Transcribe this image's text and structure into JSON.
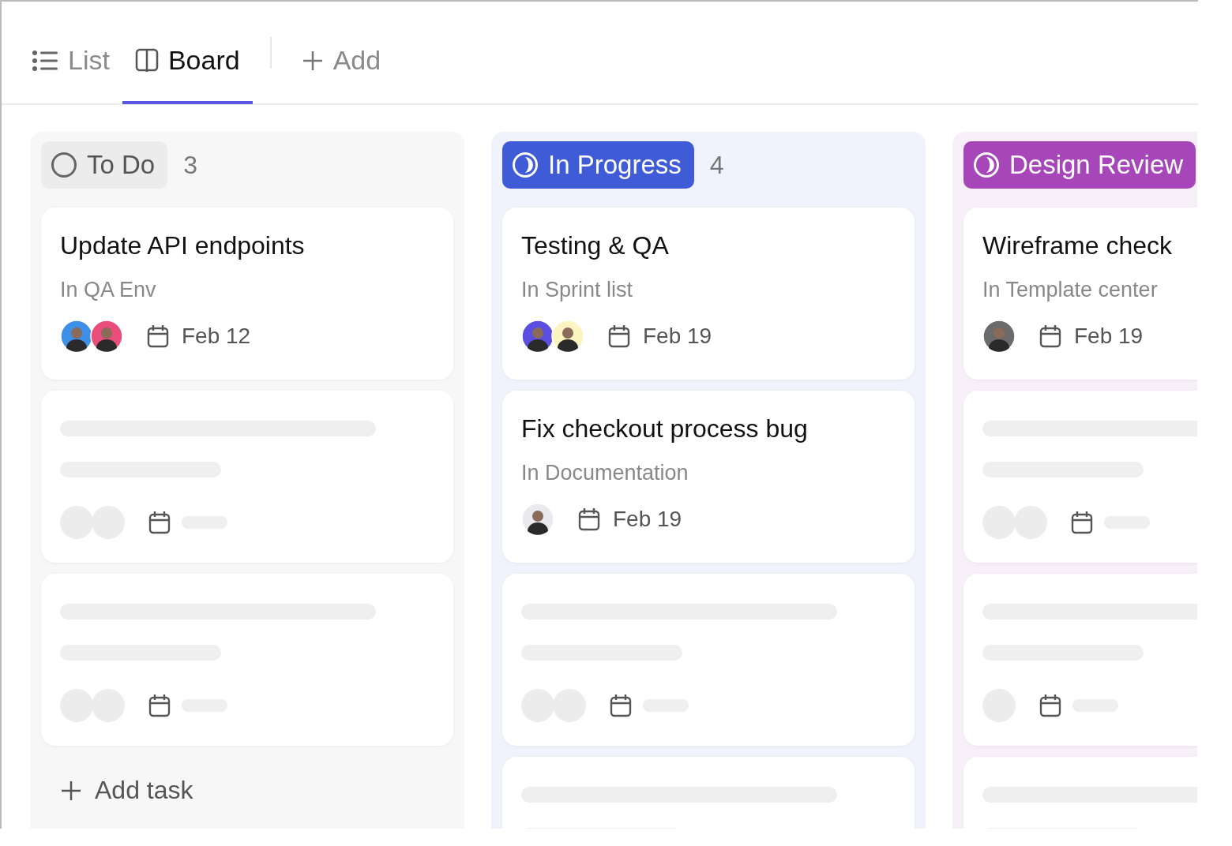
{
  "tabs": [
    {
      "kind": "list",
      "label": "List",
      "selected": false
    },
    {
      "kind": "board",
      "label": "Board",
      "selected": true
    },
    {
      "kind": "add",
      "label": "Add",
      "selected": false
    }
  ],
  "columns": [
    {
      "kind": "todo",
      "title": "To Do",
      "count": "3",
      "color": "#ececec",
      "cards": [
        {
          "kind": "task",
          "title": "Update API endpoints",
          "location": "In QA Env",
          "date": "Feb 12",
          "avatars": [
            {
              "kind": "photo",
              "color": "#3d8fe8"
            },
            {
              "kind": "photo",
              "color": "#e94d7a"
            }
          ]
        },
        {
          "kind": "skeleton",
          "avatars": [
            {
              "kind": "blank"
            },
            {
              "kind": "blank"
            }
          ]
        },
        {
          "kind": "skeleton",
          "avatars": [
            {
              "kind": "blank"
            },
            {
              "kind": "blank"
            }
          ]
        }
      ],
      "add_task": "Add task"
    },
    {
      "kind": "status",
      "title": "In Progress",
      "count": "4",
      "color": "#3f5bd6",
      "cards": [
        {
          "kind": "task",
          "title": "Testing & QA",
          "location": "In Sprint list",
          "date": "Feb 19",
          "avatars": [
            {
              "kind": "photo",
              "color": "#5a4fe0"
            },
            {
              "kind": "photo",
              "color": "#fbf3c0"
            }
          ]
        },
        {
          "kind": "task",
          "title": "Fix checkout process bug",
          "location": "In Documentation",
          "date": "Feb 19",
          "avatars": [
            {
              "kind": "photo",
              "color": "#e9e9ee"
            }
          ]
        },
        {
          "kind": "skeleton",
          "avatars": [
            {
              "kind": "blank"
            },
            {
              "kind": "blank"
            }
          ]
        },
        {
          "kind": "skeleton"
        }
      ]
    },
    {
      "kind": "status",
      "title": "Design Review",
      "color": "#a646b8",
      "cards": [
        {
          "kind": "task",
          "title": "Wireframe check",
          "location": "In Template center",
          "date": "Feb 19",
          "avatars": [
            {
              "kind": "photo",
              "color": "#6b6b6b"
            }
          ]
        },
        {
          "kind": "skeleton",
          "avatars": [
            {
              "kind": "blank"
            },
            {
              "kind": "blank"
            }
          ]
        },
        {
          "kind": "skeleton",
          "avatars": [
            {
              "kind": "blank"
            }
          ]
        },
        {
          "kind": "skeleton"
        }
      ]
    }
  ]
}
